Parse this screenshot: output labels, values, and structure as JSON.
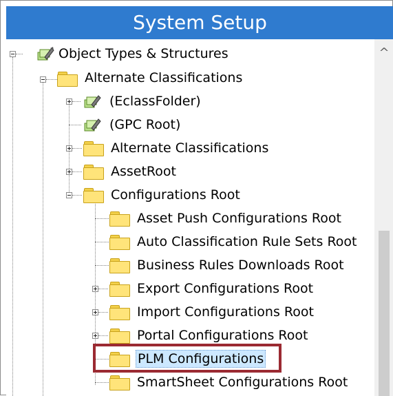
{
  "header": {
    "title": "System Setup"
  },
  "tree": {
    "nodes": [
      {
        "label": "Object Types & Structures",
        "icon": "object-type-icon",
        "expander": "minus"
      },
      {
        "label": "Alternate Classifications",
        "icon": "folder-icon",
        "expander": "minus"
      },
      {
        "label": "(EclassFolder)",
        "icon": "object-type-icon",
        "expander": "plus"
      },
      {
        "label": "(GPC Root)",
        "icon": "object-type-icon",
        "expander": "none"
      },
      {
        "label": "Alternate Classifications",
        "icon": "folder-icon",
        "expander": "plus"
      },
      {
        "label": "AssetRoot",
        "icon": "folder-icon",
        "expander": "plus"
      },
      {
        "label": "Configurations Root",
        "icon": "folder-icon",
        "expander": "minus"
      },
      {
        "label": "Asset Push Configurations Root",
        "icon": "folder-icon",
        "expander": "none"
      },
      {
        "label": "Auto Classification Rule Sets Root",
        "icon": "folder-icon",
        "expander": "none"
      },
      {
        "label": "Business Rules Downloads Root",
        "icon": "folder-icon",
        "expander": "none"
      },
      {
        "label": "Export Configurations Root",
        "icon": "folder-icon",
        "expander": "plus"
      },
      {
        "label": "Import Configurations Root",
        "icon": "folder-icon",
        "expander": "plus"
      },
      {
        "label": "Portal Configurations Root",
        "icon": "folder-icon",
        "expander": "plus"
      },
      {
        "label": "PLM Configurations",
        "icon": "folder-icon",
        "expander": "none",
        "selected": true
      },
      {
        "label": "SmartSheet Configurations Root",
        "icon": "folder-icon",
        "expander": "none"
      }
    ]
  },
  "scrollbar": {
    "up_arrow": "^"
  },
  "colors": {
    "header": "#2f7bcf",
    "highlight": "#9b2a32",
    "selection": "#cce8ff"
  }
}
